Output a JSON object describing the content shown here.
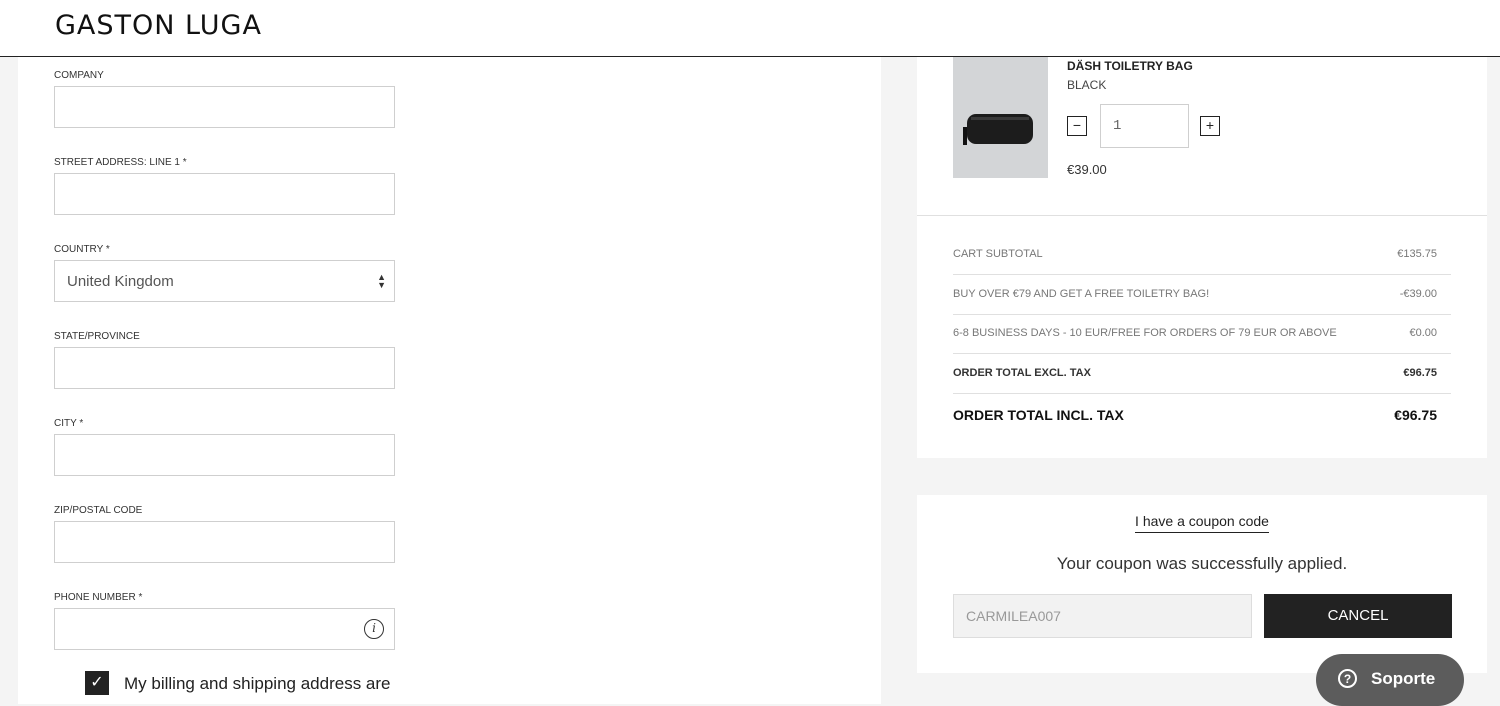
{
  "header": {
    "logo": "GASTON LUGA"
  },
  "form": {
    "company": {
      "label": "COMPANY",
      "value": ""
    },
    "street": {
      "label": "STREET ADDRESS: LINE 1 *",
      "value": ""
    },
    "country": {
      "label": "COUNTRY *",
      "value": "United Kingdom"
    },
    "state": {
      "label": "STATE/PROVINCE",
      "value": ""
    },
    "city": {
      "label": "CITY *",
      "value": ""
    },
    "zip": {
      "label": "ZIP/POSTAL CODE",
      "value": ""
    },
    "phone": {
      "label": "PHONE NUMBER *",
      "value": "",
      "info_icon": "info-icon"
    },
    "same_address": {
      "label": "My billing and shipping address are",
      "checked": true
    }
  },
  "cart": {
    "item": {
      "name": "DÄSH TOILETRY BAG",
      "color": "BLACK",
      "quantity": "1",
      "price": "€39.00",
      "minus": "−",
      "plus": "+"
    },
    "totals": [
      {
        "label": "CART SUBTOTAL",
        "value": "€135.75"
      },
      {
        "label": "BUY OVER €79 AND GET A FREE TOILETRY BAG!",
        "value": "-€39.00"
      },
      {
        "label": "6-8 BUSINESS DAYS - 10 EUR/FREE FOR ORDERS OF 79 EUR OR ABOVE",
        "value": "€0.00"
      },
      {
        "label": "ORDER TOTAL EXCL. TAX",
        "value": "€96.75"
      },
      {
        "label": "ORDER TOTAL INCL. TAX",
        "value": "€96.75"
      }
    ]
  },
  "coupon": {
    "toggle": "I have a coupon code",
    "message": "Your coupon was successfully applied.",
    "code": "CARMILEA007",
    "cancel": "CANCEL"
  },
  "support": {
    "label": "Soporte",
    "icon": "help-icon"
  }
}
